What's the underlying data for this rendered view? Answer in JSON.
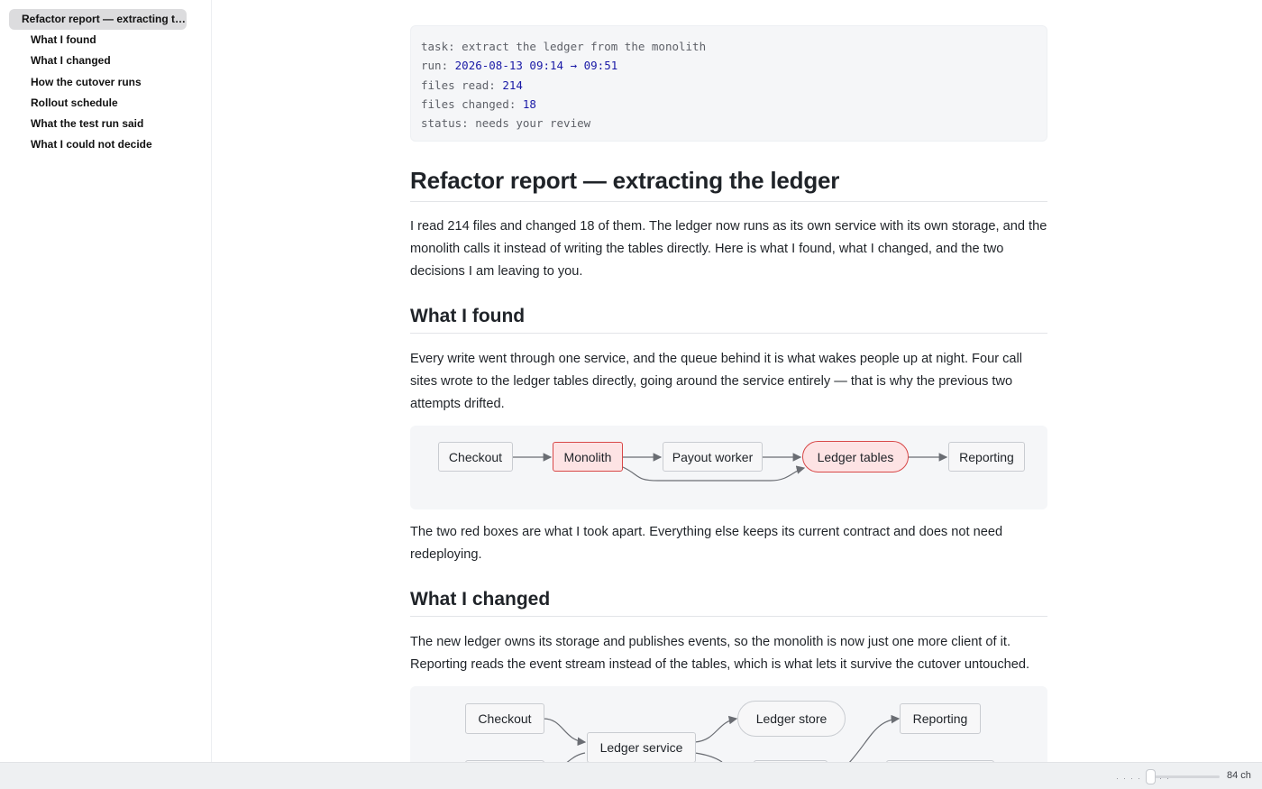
{
  "toc": {
    "items": [
      {
        "label": "Refactor report — extracting the ledger",
        "active": true
      },
      {
        "label": "What I found"
      },
      {
        "label": "What I changed"
      },
      {
        "label": "How the cutover runs"
      },
      {
        "label": "Rollout schedule"
      },
      {
        "label": "What the test run said"
      },
      {
        "label": "What I could not decide"
      }
    ]
  },
  "meta": {
    "task_key": "task:",
    "task_value": "extract the ledger from the monolith",
    "run_key": "run:",
    "run_value": "2026-08-13 09:14 → 09:51",
    "files_read_key": "files read:",
    "files_read_value": "214",
    "files_changed_key": "files changed:",
    "files_changed_value": "18",
    "status_key": "status:",
    "status_value": "needs your review"
  },
  "report": {
    "title": "Refactor report — extracting the ledger",
    "intro": "I read 214 files and changed 18 of them. The ledger now runs as its own service with its own storage, and the monolith calls it instead of writing the tables directly. Here is what I found, what I changed, and the two decisions I am leaving to you.",
    "found_heading": "What I found",
    "found_body": "Every write went through one service, and the queue behind it is what wakes people up at night. Four call sites wrote to the ledger tables directly, going around the service entirely — that is why the previous two attempts drifted.",
    "found_caption": "The two red boxes are what I took apart. Everything else keeps its current contract and does not need redeploying.",
    "changed_heading": "What I changed",
    "changed_body": "The new ledger owns its storage and publishes events, so the monolith is now just one more client of it. Reporting reads the event stream instead of the tables, which is what lets it survive the cutover untouched."
  },
  "diagram1": {
    "nodes": [
      "Checkout",
      "Monolith",
      "Payout worker",
      "Ledger tables",
      "Reporting"
    ],
    "highlight_color": "#d84848"
  },
  "diagram2": {
    "nodes": [
      "Checkout",
      "Ledger service",
      "Ledger store",
      "Reporting"
    ]
  },
  "footer": {
    "width_label": "84 ch"
  }
}
